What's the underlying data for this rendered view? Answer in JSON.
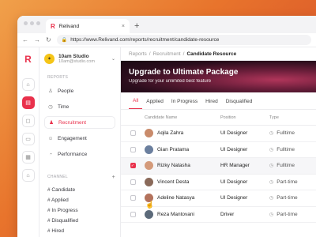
{
  "browser": {
    "tab_title": "Relivand",
    "tab_close": "×",
    "new_tab": "+",
    "url": "https://www.Relivand.com/reports/recruitment/candidate-resource",
    "nav_back": "←",
    "nav_forward": "→",
    "nav_reload": "↻"
  },
  "brand": {
    "logo": "R",
    "accent": "#e9314c"
  },
  "workspace": {
    "avatar": "✶",
    "name": "10am Studio",
    "email": "10am@studio.com",
    "chevron": "⌄"
  },
  "sidebar": {
    "reports_label": "REPORTS",
    "items": [
      {
        "icon": "users-icon",
        "glyph": "♙",
        "label": "People"
      },
      {
        "icon": "clock-icon",
        "glyph": "◷",
        "label": "Time"
      },
      {
        "icon": "recruitment-icon",
        "glyph": "♟",
        "label": "Recruitment"
      },
      {
        "icon": "engagement-icon",
        "glyph": "☺",
        "label": "Engagement"
      },
      {
        "icon": "performance-icon",
        "glyph": "◔",
        "label": "Performance"
      }
    ],
    "channel_label": "CHANNEL",
    "channel_add": "+",
    "channels": [
      "# Candidate",
      "# Applied",
      "# In Progress",
      "# Disqualified",
      "# Hired"
    ]
  },
  "breadcrumb": {
    "items": [
      "Reports",
      "Recruitment"
    ],
    "separator": "/",
    "current": "Candidate Resource"
  },
  "banner": {
    "title": "Upgrade to Ultimate Package",
    "subtitle": "Upgrade for your unlimited best feature"
  },
  "tabs": [
    "All",
    "Applied",
    "In Progress",
    "Hired",
    "Disqualified"
  ],
  "table": {
    "headers": {
      "name": "Candidate Name",
      "position": "Position",
      "type": "Type"
    },
    "rows": [
      {
        "name": "Aqila Zahra",
        "position": "UI Designer",
        "type": "Fulltime",
        "checked": false,
        "avatar_color": "#c98b6b"
      },
      {
        "name": "Gian Pratama",
        "position": "UI Designer",
        "type": "Fulltime",
        "checked": false,
        "avatar_color": "#6b7f9e"
      },
      {
        "name": "Rizky Natasha",
        "position": "HR Manager",
        "type": "Fulltime",
        "checked": true,
        "avatar_color": "#d49a7a"
      },
      {
        "name": "Vincent Desta",
        "position": "UI Designer",
        "type": "Part-time",
        "checked": false,
        "avatar_color": "#8a6a5a"
      },
      {
        "name": "Adeline Natasya",
        "position": "UI Designer",
        "type": "Part-time",
        "checked": false,
        "avatar_color": "#b3725c"
      },
      {
        "name": "Reza Mantovani",
        "position": "Driver",
        "type": "Part-time",
        "checked": false,
        "avatar_color": "#5c6a7a"
      }
    ]
  }
}
